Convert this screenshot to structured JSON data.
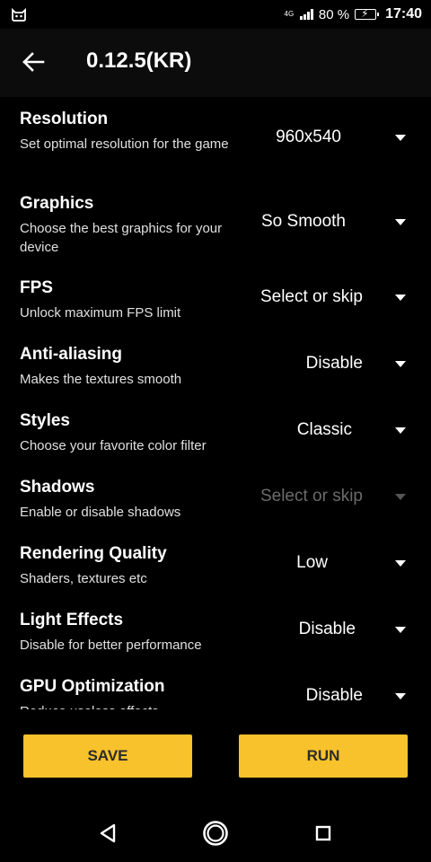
{
  "status_bar": {
    "network": "4G",
    "battery_percent": "80 %",
    "time": "17:40"
  },
  "app_bar": {
    "title": "0.12.5(KR)"
  },
  "settings": [
    {
      "title": "Resolution",
      "description": "Set optimal resolution for the game",
      "value": "960x540",
      "enabled": true
    },
    {
      "title": "Graphics",
      "description": "Choose the best graphics for your device",
      "value": "So Smooth",
      "enabled": true
    },
    {
      "title": "FPS",
      "description": "Unlock maximum FPS limit",
      "value": "Select or skip",
      "enabled": true
    },
    {
      "title": "Anti-aliasing",
      "description": "Makes the textures smooth",
      "value": "Disable",
      "enabled": true
    },
    {
      "title": "Styles",
      "description": "Choose your favorite color filter",
      "value": "Classic",
      "enabled": true
    },
    {
      "title": "Shadows",
      "description": "Enable or disable shadows",
      "value": "Select or skip",
      "enabled": false
    },
    {
      "title": "Rendering Quality",
      "description": "Shaders, textures etc",
      "value": "Low",
      "enabled": true
    },
    {
      "title": "Light Effects",
      "description": "Disable for better performance",
      "value": "Disable",
      "enabled": true
    },
    {
      "title": "GPU Optimization",
      "description": "Reduce useless effects",
      "value": "Disable",
      "enabled": true
    }
  ],
  "buttons": {
    "save_label": "SAVE",
    "run_label": "RUN"
  },
  "colors": {
    "accent": "#f7c22c",
    "background": "#000000"
  }
}
